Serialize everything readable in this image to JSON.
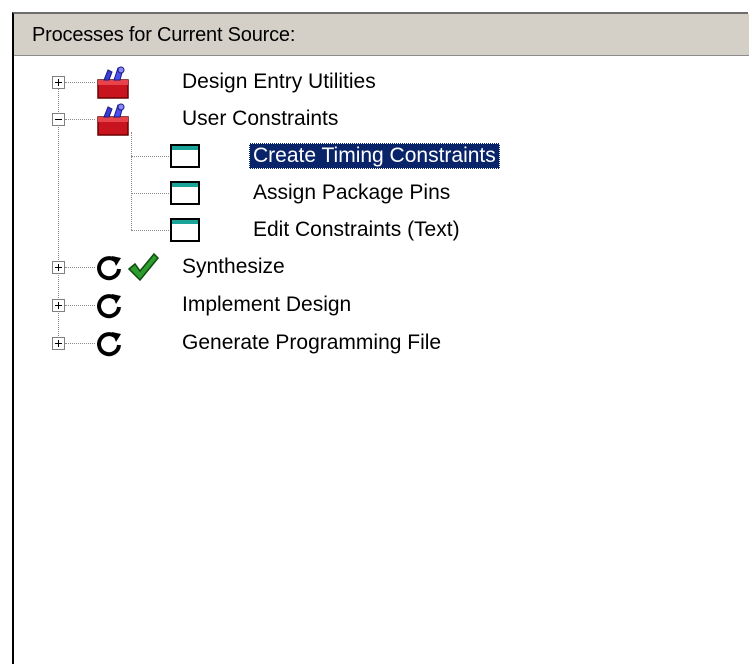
{
  "panel": {
    "title": "Processes for Current Source:"
  },
  "tree": {
    "items": [
      {
        "label": "Design Entry Utilities",
        "icon": "toolbox-icon",
        "expanded": false
      },
      {
        "label": "User Constraints",
        "icon": "toolbox-icon",
        "expanded": true,
        "children": [
          {
            "label": "Create Timing Constraints",
            "icon": "window-icon",
            "selected": true
          },
          {
            "label": "Assign Package Pins",
            "icon": "window-icon",
            "selected": false
          },
          {
            "label": "Edit Constraints (Text)",
            "icon": "window-icon",
            "selected": false
          }
        ]
      },
      {
        "label": "Synthesize",
        "icon": "refresh-icon",
        "status_icon": "checkmark-icon",
        "expanded": false
      },
      {
        "label": "Implement Design",
        "icon": "refresh-icon",
        "expanded": false
      },
      {
        "label": "Generate Programming File",
        "icon": "refresh-icon",
        "expanded": false
      }
    ]
  },
  "colors": {
    "selection": "#0a246a",
    "header_bg": "#d4d0c8",
    "checkmark": "#2e9d2e",
    "toolbox": "#c8141e",
    "window_bar": "#1aa398"
  }
}
